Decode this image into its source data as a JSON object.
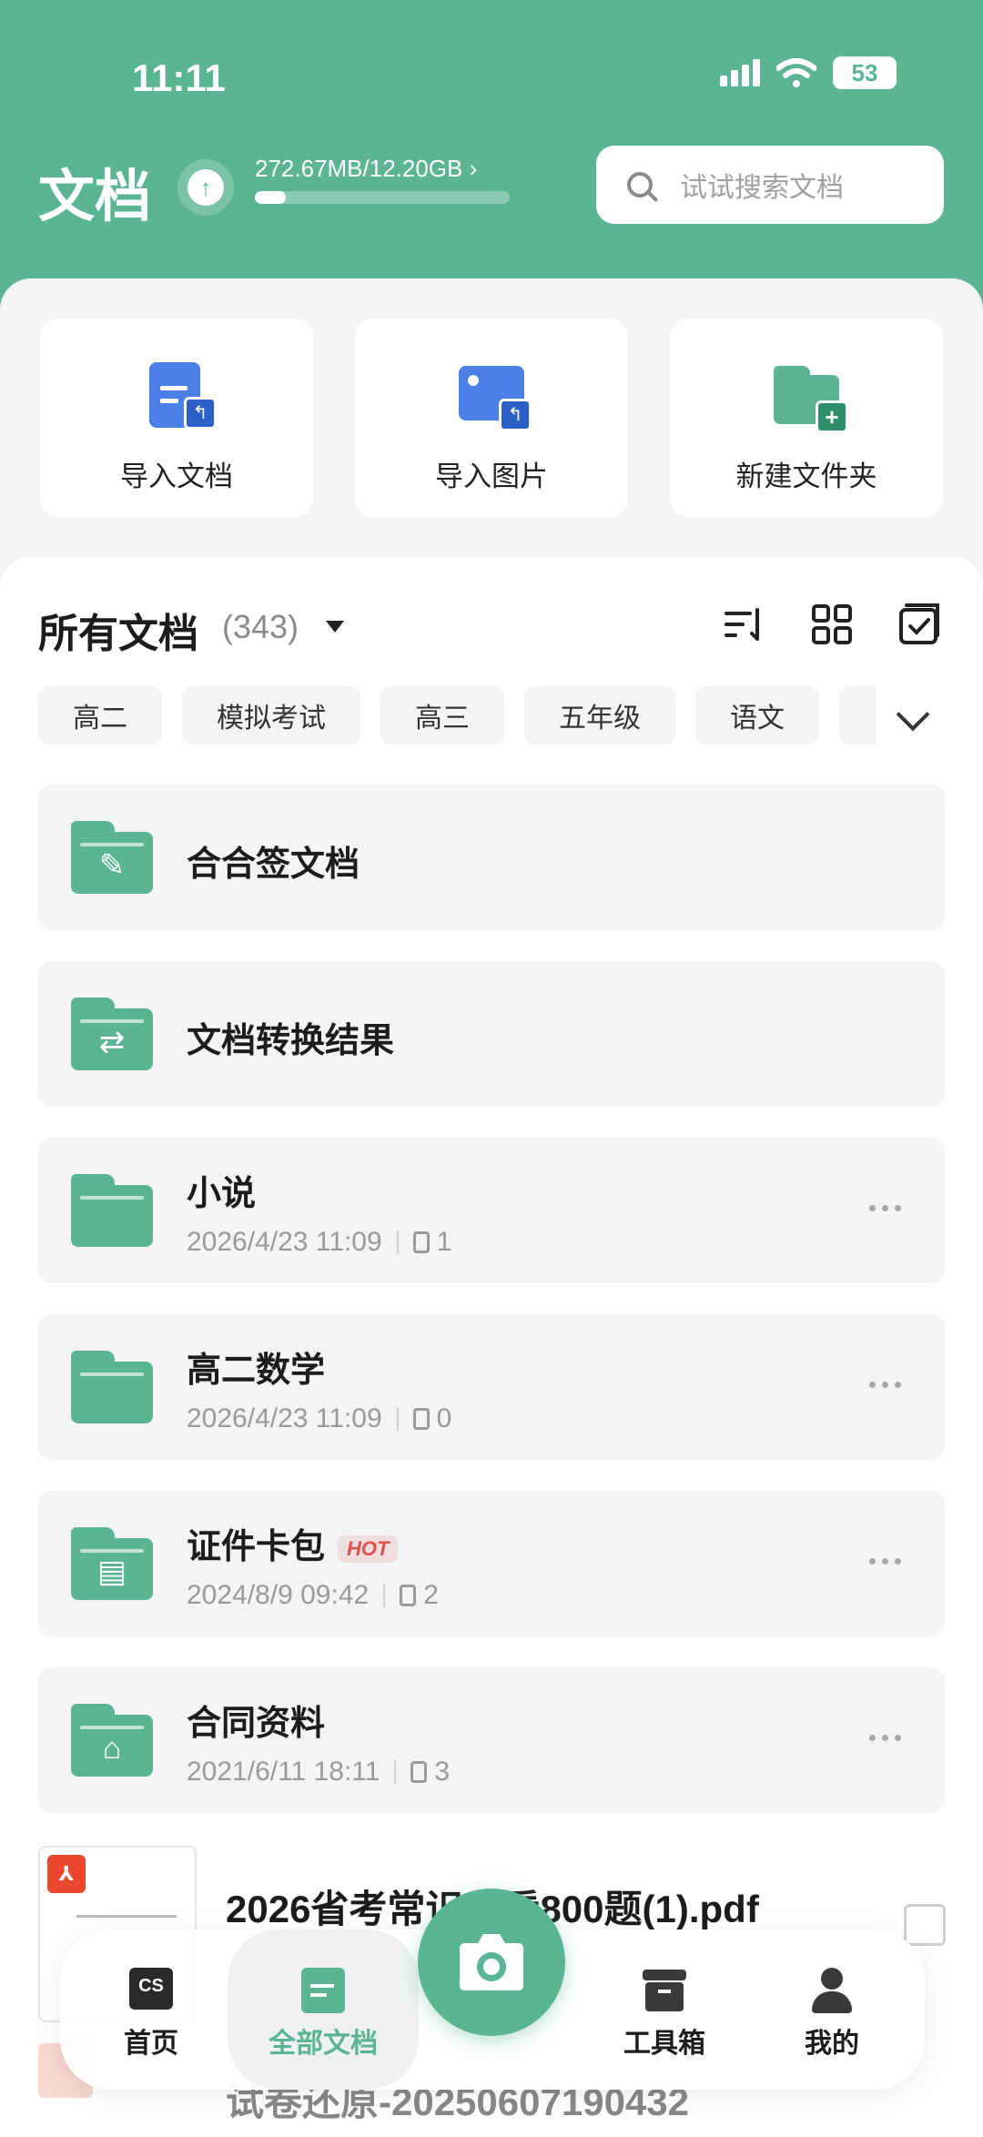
{
  "status_bar": {
    "time": "11:11",
    "battery": "53"
  },
  "header": {
    "title": "文档",
    "storage": {
      "text": "272.67MB/12.20GB",
      "chevron": "›",
      "used_fraction": 0.022
    },
    "search": {
      "placeholder": "试试搜索文档"
    }
  },
  "quick_actions": [
    {
      "label": "导入文档",
      "icon": "import-doc-icon"
    },
    {
      "label": "导入图片",
      "icon": "import-image-icon"
    },
    {
      "label": "新建文件夹",
      "icon": "new-folder-icon"
    }
  ],
  "section": {
    "title": "所有文档",
    "count": "(343)"
  },
  "tags": [
    "高二",
    "模拟考试",
    "高三",
    "五年级",
    "语文"
  ],
  "folders": [
    {
      "name": "合合签文档",
      "glyph": "✎"
    },
    {
      "name": "文档转换结果",
      "glyph": "⇄"
    },
    {
      "name": "小说",
      "date": "2026/4/23 11:09",
      "count": "1"
    },
    {
      "name": "高二数学",
      "date": "2026/4/23 11:09",
      "count": "0"
    },
    {
      "name": "证件卡包",
      "badge": "HOT",
      "date": "2024/8/9 09:42",
      "count": "2",
      "glyph": "▤"
    },
    {
      "name": "合同资料",
      "date": "2021/6/11 18:11",
      "count": "3",
      "glyph": "⌂"
    }
  ],
  "files": [
    {
      "name": "2026省考常识一看800题(1).pdf"
    },
    {
      "name": "试卷还原-20250607190432"
    }
  ],
  "bottom_nav": [
    {
      "label": "首页",
      "icon": "home-cs-icon"
    },
    {
      "label": "全部文档",
      "icon": "all-docs-icon",
      "active": true
    },
    {
      "label": "工具箱",
      "icon": "toolbox-icon"
    },
    {
      "label": "我的",
      "icon": "profile-icon"
    }
  ],
  "colors": {
    "primary": "#5bb592",
    "background": "#f3f4f6"
  }
}
